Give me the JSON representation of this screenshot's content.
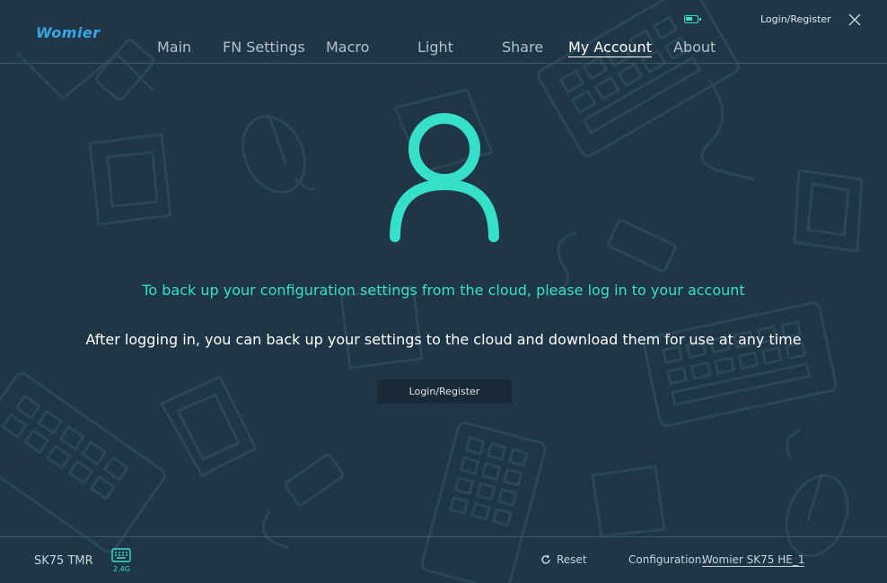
{
  "app": {
    "logo": "Womier"
  },
  "nav": {
    "items": [
      {
        "label": "Main"
      },
      {
        "label": "FN Settings"
      },
      {
        "label": "Macro"
      },
      {
        "label": "Light"
      },
      {
        "label": "Share"
      },
      {
        "label": "My Account",
        "active": true
      },
      {
        "label": "About"
      }
    ]
  },
  "header": {
    "login_label": "Login/Register",
    "battery_level": 0.6
  },
  "main": {
    "message_primary": "To back up your configuration settings from the cloud, please log in to your account",
    "message_secondary": "After logging in, you can back up your settings to the cloud and download them for use at any time",
    "login_button": "Login/Register"
  },
  "footer": {
    "device_name": "SK75 TMR",
    "connection": "2.4G",
    "reset_label": "Reset",
    "config_label": "Configuration:",
    "config_value": "Womier SK75 HE_1"
  },
  "colors": {
    "background": "#1e3646",
    "accent": "#36e0c8",
    "logo": "#3aa6e8"
  },
  "icons": [
    "battery-icon",
    "close-icon",
    "user-avatar-icon",
    "keyboard-icon",
    "reset-icon"
  ]
}
